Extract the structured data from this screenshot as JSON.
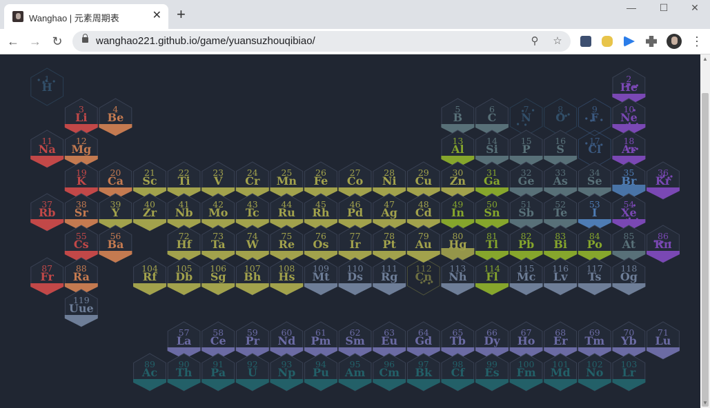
{
  "browser": {
    "tab_title": "Wanghao | 元素周期表",
    "close_glyph": "✕",
    "new_tab_glyph": "+",
    "url": "wanghao221.github.io/game/yuansuzhouqibiao/",
    "window_controls": [
      "—",
      "☐",
      "✕"
    ]
  },
  "palette": {
    "alkali": "#c24848",
    "alkaline_earth": "#c47a50",
    "transition": "#a2a24c",
    "post_transition": "#86a62c",
    "metalloid": "#587078",
    "nonmetal_other": "#3e6b8e",
    "halogen": "#4e7cb4",
    "noble_gas": "#7a48b4",
    "unknown": "#6e7e98",
    "lanthanide": "#6b6ba4",
    "actinide": "#236068",
    "outline": "#3a4254"
  },
  "elements": [
    {
      "n": "1",
      "s": "H",
      "c": "nonmetal_other",
      "g": 1,
      "p": 1,
      "faded": true
    },
    {
      "n": "2",
      "s": "He",
      "c": "noble_gas",
      "g": 18,
      "p": 1
    },
    {
      "n": "3",
      "s": "Li",
      "c": "alkali",
      "g": 2,
      "p": 2
    },
    {
      "n": "4",
      "s": "Be",
      "c": "alkaline_earth",
      "g": 3,
      "p": 2
    },
    {
      "n": "5",
      "s": "B",
      "c": "metalloid",
      "g": 13,
      "p": 2
    },
    {
      "n": "6",
      "s": "C",
      "c": "metalloid",
      "g": 14,
      "p": 2
    },
    {
      "n": "7",
      "s": "N",
      "c": "nonmetal_other",
      "g": 15,
      "p": 2,
      "faded": true
    },
    {
      "n": "8",
      "s": "O",
      "c": "nonmetal_other",
      "g": 16,
      "p": 2,
      "faded": true
    },
    {
      "n": "9",
      "s": "F",
      "c": "halogen",
      "g": 17,
      "p": 2,
      "faded": true
    },
    {
      "n": "10",
      "s": "Ne",
      "c": "noble_gas",
      "g": 18,
      "p": 2
    },
    {
      "n": "11",
      "s": "Na",
      "c": "alkali",
      "g": 1,
      "p": 3
    },
    {
      "n": "12",
      "s": "Mg",
      "c": "alkaline_earth",
      "g": 2,
      "p": 3
    },
    {
      "n": "13",
      "s": "Al",
      "c": "post_transition",
      "g": 13,
      "p": 3
    },
    {
      "n": "14",
      "s": "Si",
      "c": "metalloid",
      "g": 14,
      "p": 3
    },
    {
      "n": "15",
      "s": "P",
      "c": "metalloid",
      "g": 15,
      "p": 3
    },
    {
      "n": "16",
      "s": "S",
      "c": "metalloid",
      "g": 16,
      "p": 3
    },
    {
      "n": "17",
      "s": "Cl",
      "c": "halogen",
      "g": 17,
      "p": 3,
      "faded": true
    },
    {
      "n": "18",
      "s": "Ar",
      "c": "noble_gas",
      "g": 18,
      "p": 3
    },
    {
      "n": "19",
      "s": "K",
      "c": "alkali",
      "g": 2,
      "p": 4
    },
    {
      "n": "20",
      "s": "Ca",
      "c": "alkaline_earth",
      "g": 3,
      "p": 4
    },
    {
      "n": "21",
      "s": "Sc",
      "c": "transition",
      "g": 4,
      "p": 4
    },
    {
      "n": "22",
      "s": "Ti",
      "c": "transition",
      "g": 5,
      "p": 4
    },
    {
      "n": "23",
      "s": "V",
      "c": "transition",
      "g": 6,
      "p": 4
    },
    {
      "n": "24",
      "s": "Cr",
      "c": "transition",
      "g": 7,
      "p": 4
    },
    {
      "n": "25",
      "s": "Mn",
      "c": "transition",
      "g": 8,
      "p": 4
    },
    {
      "n": "26",
      "s": "Fe",
      "c": "transition",
      "g": 9,
      "p": 4
    },
    {
      "n": "27",
      "s": "Co",
      "c": "transition",
      "g": 10,
      "p": 4
    },
    {
      "n": "28",
      "s": "Ni",
      "c": "transition",
      "g": 11,
      "p": 4
    },
    {
      "n": "29",
      "s": "Cu",
      "c": "transition",
      "g": 12,
      "p": 4
    },
    {
      "n": "30",
      "s": "Zn",
      "c": "transition",
      "g": 13,
      "p": 4
    },
    {
      "n": "31",
      "s": "Ga",
      "c": "post_transition",
      "g": 14,
      "p": 4
    },
    {
      "n": "32",
      "s": "Ge",
      "c": "metalloid",
      "g": 15,
      "p": 4
    },
    {
      "n": "33",
      "s": "As",
      "c": "metalloid",
      "g": 16,
      "p": 4
    },
    {
      "n": "34",
      "s": "Se",
      "c": "metalloid",
      "g": 17,
      "p": 4
    },
    {
      "n": "35",
      "s": "Br",
      "c": "halogen",
      "g": 18,
      "p": 4,
      "liquid": true
    },
    {
      "n": "36",
      "s": "Kr",
      "c": "noble_gas",
      "g": 19,
      "p": 4
    },
    {
      "n": "37",
      "s": "Rb",
      "c": "alkali",
      "g": 1,
      "p": 5
    },
    {
      "n": "38",
      "s": "Sr",
      "c": "alkaline_earth",
      "g": 2,
      "p": 5
    },
    {
      "n": "39",
      "s": "Y",
      "c": "transition",
      "g": 3,
      "p": 5
    },
    {
      "n": "40",
      "s": "Zr",
      "c": "transition",
      "g": 4,
      "p": 5
    },
    {
      "n": "41",
      "s": "Nb",
      "c": "transition",
      "g": 5,
      "p": 5
    },
    {
      "n": "42",
      "s": "Mo",
      "c": "transition",
      "g": 6,
      "p": 5
    },
    {
      "n": "43",
      "s": "Tc",
      "c": "transition",
      "g": 7,
      "p": 5
    },
    {
      "n": "44",
      "s": "Ru",
      "c": "transition",
      "g": 8,
      "p": 5
    },
    {
      "n": "45",
      "s": "Rh",
      "c": "transition",
      "g": 9,
      "p": 5
    },
    {
      "n": "46",
      "s": "Pd",
      "c": "transition",
      "g": 10,
      "p": 5
    },
    {
      "n": "47",
      "s": "Ag",
      "c": "transition",
      "g": 11,
      "p": 5
    },
    {
      "n": "48",
      "s": "Cd",
      "c": "transition",
      "g": 12,
      "p": 5
    },
    {
      "n": "49",
      "s": "In",
      "c": "post_transition",
      "g": 13,
      "p": 5
    },
    {
      "n": "50",
      "s": "Sn",
      "c": "post_transition",
      "g": 14,
      "p": 5
    },
    {
      "n": "51",
      "s": "Sb",
      "c": "metalloid",
      "g": 15,
      "p": 5
    },
    {
      "n": "52",
      "s": "Te",
      "c": "metalloid",
      "g": 16,
      "p": 5
    },
    {
      "n": "53",
      "s": "I",
      "c": "halogen",
      "g": 17,
      "p": 5
    },
    {
      "n": "54",
      "s": "Xe",
      "c": "noble_gas",
      "g": 18,
      "p": 5
    },
    {
      "n": "55",
      "s": "Cs",
      "c": "alkali",
      "g": 2,
      "p": 6
    },
    {
      "n": "56",
      "s": "Ba",
      "c": "alkaline_earth",
      "g": 3,
      "p": 6
    },
    {
      "n": "72",
      "s": "Hf",
      "c": "transition",
      "g": 5,
      "p": 6
    },
    {
      "n": "73",
      "s": "Ta",
      "c": "transition",
      "g": 6,
      "p": 6
    },
    {
      "n": "74",
      "s": "W",
      "c": "transition",
      "g": 7,
      "p": 6
    },
    {
      "n": "75",
      "s": "Re",
      "c": "transition",
      "g": 8,
      "p": 6
    },
    {
      "n": "76",
      "s": "Os",
      "c": "transition",
      "g": 9,
      "p": 6
    },
    {
      "n": "77",
      "s": "Ir",
      "c": "transition",
      "g": 10,
      "p": 6
    },
    {
      "n": "78",
      "s": "Pt",
      "c": "transition",
      "g": 11,
      "p": 6
    },
    {
      "n": "79",
      "s": "Au",
      "c": "transition",
      "g": 12,
      "p": 6
    },
    {
      "n": "80",
      "s": "Hg",
      "c": "transition",
      "g": 13,
      "p": 6,
      "liquid": true
    },
    {
      "n": "81",
      "s": "Tl",
      "c": "post_transition",
      "g": 14,
      "p": 6
    },
    {
      "n": "82",
      "s": "Pb",
      "c": "post_transition",
      "g": 15,
      "p": 6
    },
    {
      "n": "83",
      "s": "Bi",
      "c": "post_transition",
      "g": 16,
      "p": 6
    },
    {
      "n": "84",
      "s": "Po",
      "c": "post_transition",
      "g": 17,
      "p": 6
    },
    {
      "n": "85",
      "s": "At",
      "c": "metalloid",
      "g": 18,
      "p": 6
    },
    {
      "n": "86",
      "s": "Rn",
      "c": "noble_gas",
      "g": 19,
      "p": 6
    },
    {
      "n": "87",
      "s": "Fr",
      "c": "alkali",
      "g": 1,
      "p": 7
    },
    {
      "n": "88",
      "s": "Ra",
      "c": "alkaline_earth",
      "g": 2,
      "p": 7
    },
    {
      "n": "104",
      "s": "Rf",
      "c": "transition",
      "g": 4,
      "p": 7
    },
    {
      "n": "105",
      "s": "Db",
      "c": "transition",
      "g": 5,
      "p": 7
    },
    {
      "n": "106",
      "s": "Sg",
      "c": "transition",
      "g": 6,
      "p": 7
    },
    {
      "n": "107",
      "s": "Bh",
      "c": "transition",
      "g": 7,
      "p": 7
    },
    {
      "n": "108",
      "s": "Hs",
      "c": "transition",
      "g": 8,
      "p": 7
    },
    {
      "n": "109",
      "s": "Mt",
      "c": "unknown",
      "g": 9,
      "p": 7
    },
    {
      "n": "110",
      "s": "Ds",
      "c": "unknown",
      "g": 10,
      "p": 7
    },
    {
      "n": "111",
      "s": "Rg",
      "c": "unknown",
      "g": 11,
      "p": 7
    },
    {
      "n": "112",
      "s": "Cn",
      "c": "transition",
      "g": 12,
      "p": 7,
      "faded": true
    },
    {
      "n": "113",
      "s": "Nh",
      "c": "unknown",
      "g": 13,
      "p": 7
    },
    {
      "n": "114",
      "s": "Fl",
      "c": "post_transition",
      "g": 14,
      "p": 7
    },
    {
      "n": "115",
      "s": "Mc",
      "c": "unknown",
      "g": 15,
      "p": 7
    },
    {
      "n": "116",
      "s": "Lv",
      "c": "unknown",
      "g": 16,
      "p": 7
    },
    {
      "n": "117",
      "s": "Ts",
      "c": "unknown",
      "g": 17,
      "p": 7
    },
    {
      "n": "118",
      "s": "Og",
      "c": "unknown",
      "g": 18,
      "p": 7
    },
    {
      "n": "119",
      "s": "Uue",
      "c": "unknown",
      "g": 2,
      "p": 8
    },
    {
      "n": "57",
      "s": "La",
      "c": "lanthanide",
      "g": 5,
      "p": 9
    },
    {
      "n": "58",
      "s": "Ce",
      "c": "lanthanide",
      "g": 6,
      "p": 9
    },
    {
      "n": "59",
      "s": "Pr",
      "c": "lanthanide",
      "g": 7,
      "p": 9
    },
    {
      "n": "60",
      "s": "Nd",
      "c": "lanthanide",
      "g": 8,
      "p": 9
    },
    {
      "n": "61",
      "s": "Pm",
      "c": "lanthanide",
      "g": 9,
      "p": 9
    },
    {
      "n": "62",
      "s": "Sm",
      "c": "lanthanide",
      "g": 10,
      "p": 9
    },
    {
      "n": "63",
      "s": "Eu",
      "c": "lanthanide",
      "g": 11,
      "p": 9
    },
    {
      "n": "64",
      "s": "Gd",
      "c": "lanthanide",
      "g": 12,
      "p": 9
    },
    {
      "n": "65",
      "s": "Tb",
      "c": "lanthanide",
      "g": 13,
      "p": 9
    },
    {
      "n": "66",
      "s": "Dy",
      "c": "lanthanide",
      "g": 14,
      "p": 9
    },
    {
      "n": "67",
      "s": "Ho",
      "c": "lanthanide",
      "g": 15,
      "p": 9
    },
    {
      "n": "68",
      "s": "Er",
      "c": "lanthanide",
      "g": 16,
      "p": 9
    },
    {
      "n": "69",
      "s": "Tm",
      "c": "lanthanide",
      "g": 17,
      "p": 9
    },
    {
      "n": "70",
      "s": "Yb",
      "c": "lanthanide",
      "g": 18,
      "p": 9
    },
    {
      "n": "71",
      "s": "Lu",
      "c": "lanthanide",
      "g": 19,
      "p": 9
    },
    {
      "n": "89",
      "s": "Ac",
      "c": "actinide",
      "g": 4,
      "p": 10
    },
    {
      "n": "90",
      "s": "Th",
      "c": "actinide",
      "g": 5,
      "p": 10
    },
    {
      "n": "91",
      "s": "Pa",
      "c": "actinide",
      "g": 6,
      "p": 10
    },
    {
      "n": "92",
      "s": "U",
      "c": "actinide",
      "g": 7,
      "p": 10
    },
    {
      "n": "93",
      "s": "Np",
      "c": "actinide",
      "g": 8,
      "p": 10
    },
    {
      "n": "94",
      "s": "Pu",
      "c": "actinide",
      "g": 9,
      "p": 10
    },
    {
      "n": "95",
      "s": "Am",
      "c": "actinide",
      "g": 10,
      "p": 10
    },
    {
      "n": "96",
      "s": "Cm",
      "c": "actinide",
      "g": 11,
      "p": 10
    },
    {
      "n": "97",
      "s": "Bk",
      "c": "actinide",
      "g": 12,
      "p": 10
    },
    {
      "n": "98",
      "s": "Cf",
      "c": "actinide",
      "g": 13,
      "p": 10
    },
    {
      "n": "99",
      "s": "Es",
      "c": "actinide",
      "g": 14,
      "p": 10
    },
    {
      "n": "100",
      "s": "Fm",
      "c": "actinide",
      "g": 15,
      "p": 10
    },
    {
      "n": "101",
      "s": "Md",
      "c": "actinide",
      "g": 16,
      "p": 10
    },
    {
      "n": "102",
      "s": "No",
      "c": "actinide",
      "g": 17,
      "p": 10
    },
    {
      "n": "103",
      "s": "Lr",
      "c": "actinide",
      "g": 18,
      "p": 10
    }
  ]
}
